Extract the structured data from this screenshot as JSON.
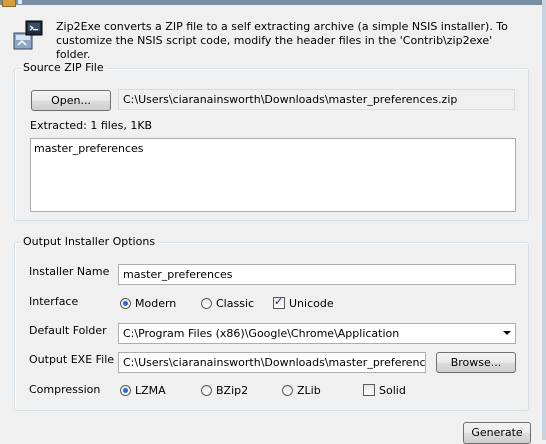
{
  "header": {
    "description": "Zip2Exe converts a ZIP file to a self extracting archive (a simple NSIS installer). To customize the NSIS script code, modify the header files in the 'Contrib\\zip2exe' folder."
  },
  "source": {
    "group_title": "Source ZIP File",
    "open_label": "Open...",
    "zip_path": "C:\\Users\\ciaranainsworth\\Downloads\\master_preferences.zip",
    "extracted_text": "Extracted: 1 files, 1KB",
    "file_list": "master_preferences"
  },
  "output": {
    "group_title": "Output Installer Options",
    "installer_name_label": "Installer Name",
    "installer_name_value": "master_preferences",
    "interface_label": "Interface",
    "interface_options": {
      "modern": "Modern",
      "classic": "Classic",
      "unicode": "Unicode"
    },
    "default_folder_label": "Default Folder",
    "default_folder_value": "C:\\Program Files (x86)\\Google\\Chrome\\Application",
    "output_exe_label": "Output EXE File",
    "output_exe_value": "C:\\Users\\ciaranainsworth\\Downloads\\master_preferences.exe",
    "browse_label": "Browse...",
    "compression_label": "Compression",
    "compression_options": {
      "lzma": "LZMA",
      "bzip2": "BZip2",
      "zlib": "ZLib",
      "solid": "Solid"
    }
  },
  "footer": {
    "generate_label": "Generate"
  },
  "colors": {
    "window_bg": "#f0f0f0",
    "group_border": "#d5dfe5",
    "radio_selected": "#2a6ad6"
  }
}
